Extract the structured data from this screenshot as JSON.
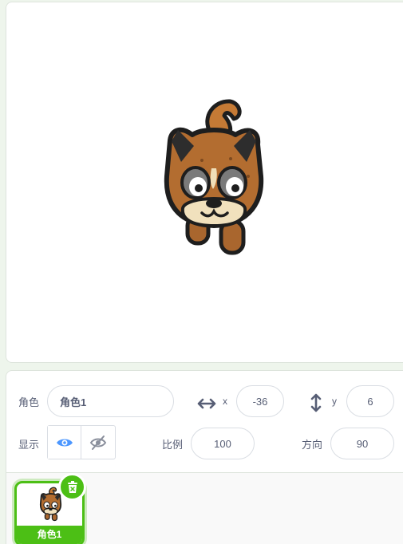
{
  "sprite_info": {
    "sprite_label": "角色",
    "sprite_name": "角色1",
    "x_label": "x",
    "x_value": "-36",
    "y_label": "y",
    "y_value": "6",
    "show_label": "显示",
    "size_label": "比例",
    "size_value": "100",
    "direction_label": "方向",
    "direction_value": "90"
  },
  "sprite_list": {
    "items": [
      {
        "name": "角色1",
        "selected": true
      }
    ]
  },
  "colors": {
    "accent": "#4cbf15",
    "text": "#575e75",
    "eye_icon": "#4c97ff"
  }
}
